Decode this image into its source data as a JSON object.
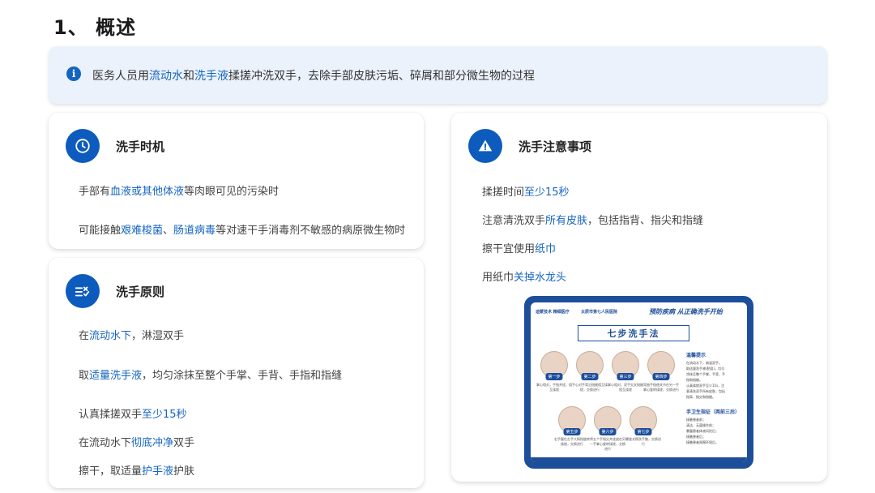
{
  "page": {
    "title": "1、 概述"
  },
  "overview": {
    "parts": [
      "医务人员用",
      "流动水",
      "和",
      "洗手液",
      "揉搓冲洗双手，去除手部皮肤污垢、碎屑和部分微生物的过程"
    ]
  },
  "timing": {
    "title": "洗手时机",
    "icon": "clock-icon",
    "items": [
      [
        "手部有",
        "血液或其他体液",
        "等肉眼可见的污染时"
      ],
      [
        "可能接触",
        "艰难梭菌",
        "、",
        "肠道病毒",
        "等对速干手消毒剂不敏感的病原微生物时"
      ]
    ]
  },
  "principles": {
    "title": "洗手原则",
    "icon": "checklist-icon",
    "items": [
      [
        "在",
        "流动水下",
        "，淋湿双手"
      ],
      [
        "取",
        "适量洗手液",
        "，均匀涂抹至整个手掌、手背、手指和指缝"
      ],
      [
        "认真揉搓双手",
        "至少15秒"
      ],
      [
        "在流动水下",
        "彻底冲净",
        "双手"
      ],
      [
        "擦干，取适量",
        "护手液",
        "护肤"
      ]
    ]
  },
  "notes": {
    "title": "洗手注意事项",
    "icon": "warning-icon",
    "items": [
      [
        "揉搓时间",
        "至少15秒"
      ],
      [
        "注意清洗双手",
        "所有皮肤",
        "，包括指背、指尖和指缝"
      ],
      [
        "擦干宜使用",
        "纸巾"
      ],
      [
        "用纸巾",
        "关掉水龙头"
      ]
    ]
  },
  "poster": {
    "logo_left": "迪蒙技术 精细医疗",
    "logo_right": "太原市第七人民医院",
    "slogan": "预防疾病 从正确洗手开始",
    "title": "七步洗手法",
    "steps": [
      "第一步",
      "第二步",
      "第三步",
      "第四步",
      "第五步",
      "第六步",
      "第七步"
    ],
    "captions": [
      "掌心相对，手指并拢，相互揉搓",
      "手心对手背沿指缝相互揉搓，交换进行",
      "掌心相对，双手交叉指缝相互揉搓",
      "弯曲手指使关节在另一手掌心旋转揉搓，交换进行",
      "右手握住左手大拇指旋转揉搓，交换进行",
      "将五个手指尖并拢放在另一手掌心旋转揉搓，交换进行",
      "螺旋式擦洗手腕，交换进行"
    ],
    "tips_title": "温馨提示",
    "tips": [
      "在流动水下，淋湿双手。",
      "取适量洗手液(肥皂)，均匀",
      "涂抹至整个手掌、手背、手",
      "指和指缝。",
      "认真揉搓双手至少15s，注",
      "意清洗双手所有皮肤，包括",
      "指背、指尖和指缝。"
    ],
    "moments_title": "手卫生指征（两前三后）",
    "moments": [
      "接触患者前；",
      "清洁、无菌操作前；",
      "暴露患者体液风险后；",
      "接触患者后；",
      "接触患者周围环境后。"
    ],
    "accent": "#1d4e9a"
  },
  "colors": {
    "accent": "#1565c0",
    "circle": "#0d5bbd",
    "banner_bg": "#ebf2fc"
  }
}
